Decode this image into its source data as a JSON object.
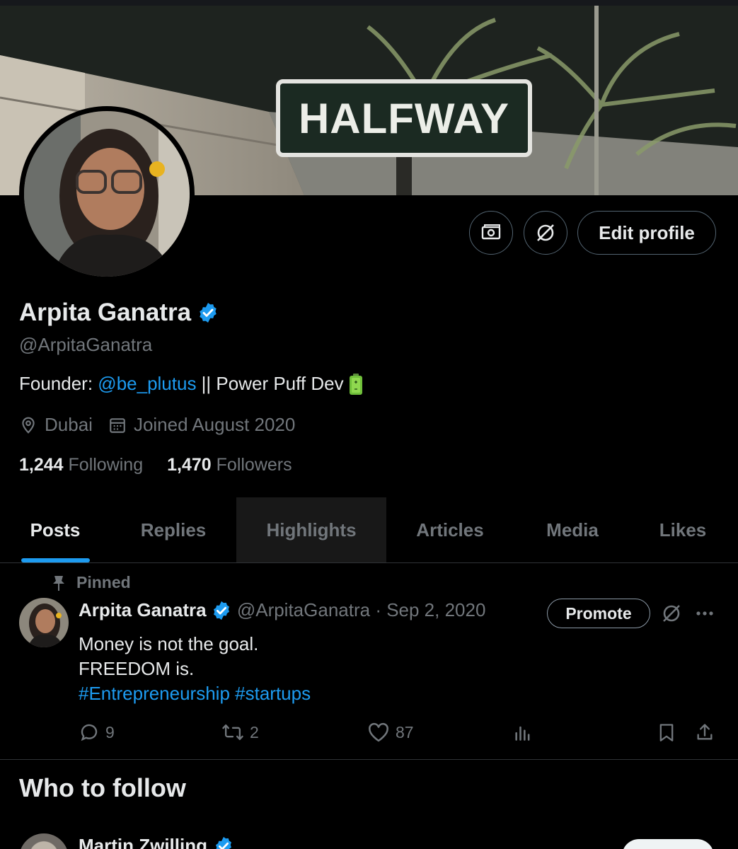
{
  "banner": {
    "sign_text": "HALFWAY"
  },
  "header": {
    "edit_profile": "Edit profile",
    "monetization_icon": "money-icon",
    "grok_icon": "grok-icon"
  },
  "profile": {
    "name": "Arpita Ganatra",
    "handle": "@ArpitaGanatra",
    "bio": {
      "prefix": "Founder: ",
      "mention": "@be_plutus",
      "suffix": " || Power Puff Dev "
    },
    "location": "Dubai",
    "joined": "Joined August 2020",
    "following_count": "1,244",
    "following_label": "Following",
    "followers_count": "1,470",
    "followers_label": "Followers"
  },
  "tabs": [
    {
      "label": "Posts"
    },
    {
      "label": "Replies"
    },
    {
      "label": "Highlights"
    },
    {
      "label": "Articles"
    },
    {
      "label": "Media"
    },
    {
      "label": "Likes"
    }
  ],
  "tweet": {
    "pinned_label": "Pinned",
    "author": "Arpita Ganatra",
    "handle_date": " @ArpitaGanatra · Sep 2, 2020",
    "promote_label": "Promote",
    "line1": "Money is not the goal.",
    "line2": "FREEDOM is.",
    "hashtag1": "#Entrepreneurship",
    "hashtag2": "#startups",
    "replies": "9",
    "reposts": "2",
    "likes": "87"
  },
  "who_to_follow": {
    "title": "Who to follow",
    "first_name": "Martin Zwilling"
  },
  "colors": {
    "accent": "#1d9bf0",
    "muted": "#71767b",
    "text": "#e7e9ea",
    "border": "#2f3336"
  }
}
